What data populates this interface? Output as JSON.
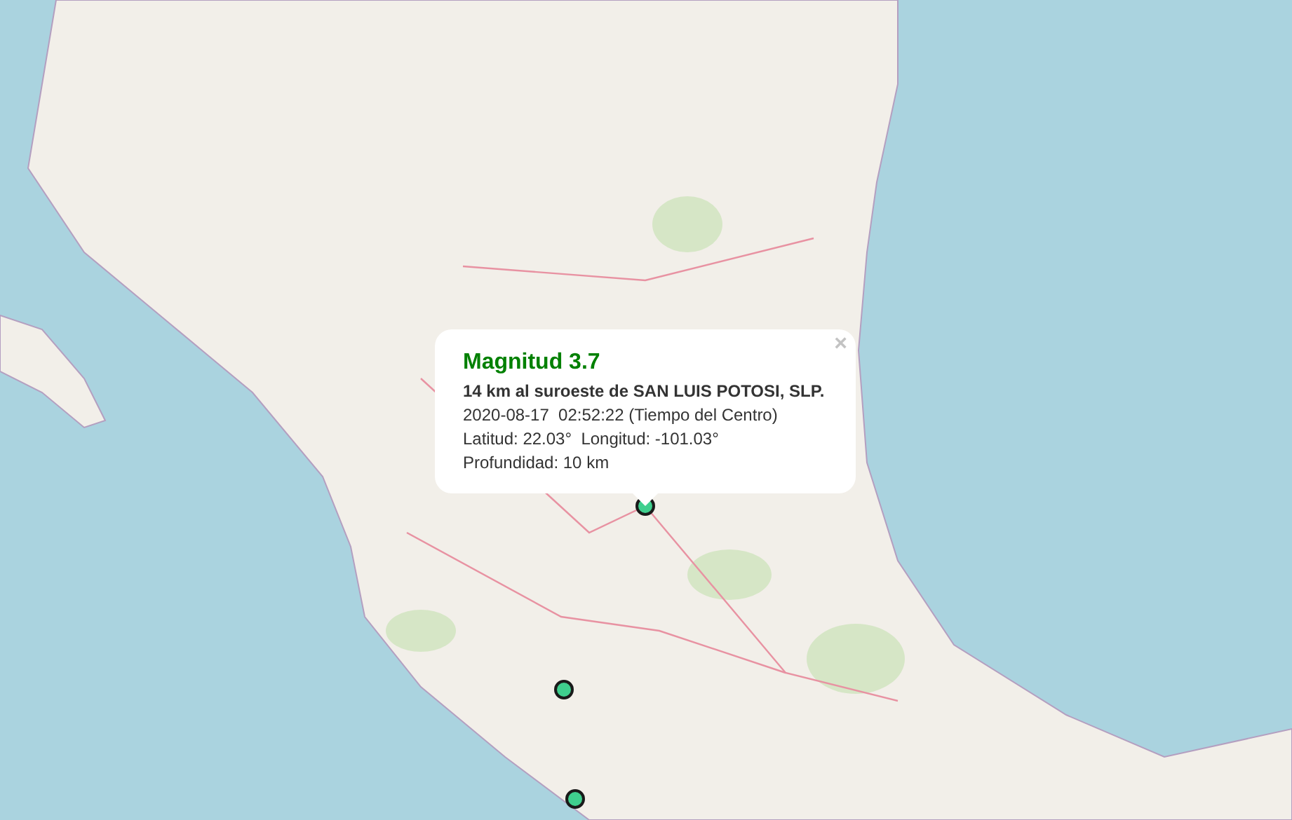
{
  "popup": {
    "close": "×",
    "title": "Magnitud 3.7",
    "location": "14 km al suroeste de SAN LUIS POTOSI, SLP.",
    "datetime": "2020-08-17  02:52:22 (Tiempo del Centro)",
    "coordinates": "Latitud: 22.03°  Longitud: -101.03°",
    "depth": "Profundidad: 10 km"
  }
}
